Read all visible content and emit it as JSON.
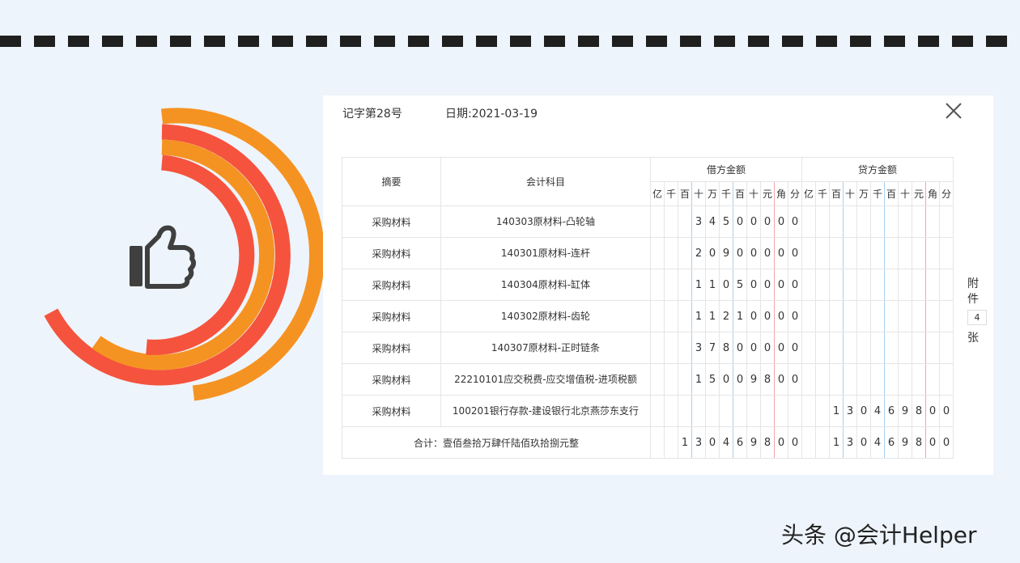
{
  "voucher": {
    "word_no": "记字第28号",
    "date": "日期:2021-03-19",
    "headers": {
      "summary": "摘要",
      "account": "会计科目",
      "debit": "借方金额",
      "credit": "贷方金额",
      "digit_units": [
        "亿",
        "千",
        "百",
        "十",
        "万",
        "千",
        "百",
        "十",
        "元",
        "角",
        "分"
      ]
    },
    "rows": [
      {
        "summary": "采购材料",
        "account": "140303原材料-凸轮轴",
        "debit": [
          "",
          "",
          "",
          "3",
          "4",
          "5",
          "0",
          "0",
          "0",
          "0",
          "0"
        ],
        "credit": [
          "",
          "",
          "",
          "",
          "",
          "",
          "",
          "",
          "",
          "",
          ""
        ]
      },
      {
        "summary": "采购材料",
        "account": "140301原材料-连杆",
        "debit": [
          "",
          "",
          "",
          "2",
          "0",
          "9",
          "0",
          "0",
          "0",
          "0",
          "0"
        ],
        "credit": [
          "",
          "",
          "",
          "",
          "",
          "",
          "",
          "",
          "",
          "",
          ""
        ]
      },
      {
        "summary": "采购材料",
        "account": "140304原材料-缸体",
        "debit": [
          "",
          "",
          "",
          "1",
          "1",
          "0",
          "5",
          "0",
          "0",
          "0",
          "0"
        ],
        "credit": [
          "",
          "",
          "",
          "",
          "",
          "",
          "",
          "",
          "",
          "",
          ""
        ]
      },
      {
        "summary": "采购材料",
        "account": "140302原材料-齿轮",
        "debit": [
          "",
          "",
          "",
          "1",
          "1",
          "2",
          "1",
          "0",
          "0",
          "0",
          "0"
        ],
        "credit": [
          "",
          "",
          "",
          "",
          "",
          "",
          "",
          "",
          "",
          "",
          ""
        ]
      },
      {
        "summary": "采购材料",
        "account": "140307原材料-正时链条",
        "debit": [
          "",
          "",
          "",
          "3",
          "7",
          "8",
          "0",
          "0",
          "0",
          "0",
          "0"
        ],
        "credit": [
          "",
          "",
          "",
          "",
          "",
          "",
          "",
          "",
          "",
          "",
          ""
        ]
      },
      {
        "summary": "采购材料",
        "account": "22210101应交税费-应交增值税-进项税额",
        "debit": [
          "",
          "",
          "",
          "1",
          "5",
          "0",
          "0",
          "9",
          "8",
          "0",
          "0"
        ],
        "credit": [
          "",
          "",
          "",
          "",
          "",
          "",
          "",
          "",
          "",
          "",
          ""
        ]
      },
      {
        "summary": "采购材料",
        "account": "100201银行存款-建设银行北京燕莎东支行",
        "debit": [
          "",
          "",
          "",
          "",
          "",
          "",
          "",
          "",
          "",
          "",
          ""
        ],
        "credit": [
          "",
          "",
          "1",
          "3",
          "0",
          "4",
          "6",
          "9",
          "8",
          "0",
          "0"
        ]
      }
    ],
    "total": {
      "label": "合计：壹佰叁拾万肆仟陆佰玖拾捌元整",
      "debit": [
        "",
        "",
        "1",
        "3",
        "0",
        "4",
        "6",
        "9",
        "8",
        "0",
        "0"
      ],
      "credit": [
        "",
        "",
        "1",
        "3",
        "0",
        "4",
        "6",
        "9",
        "8",
        "0",
        "0"
      ]
    },
    "attachment": {
      "label_top": "附",
      "label_mid": "件",
      "count": "4",
      "label_bottom": "张"
    }
  },
  "icons": {
    "close": "close-icon",
    "thumb": "thumbs-up-icon"
  },
  "colors": {
    "orange": "#f59322",
    "red": "#f5533d",
    "thumb": "#3f3f3f",
    "blue_line": "#a8d0f0",
    "red_line": "#f2a5a5"
  },
  "watermark": "头条 @会计Helper"
}
